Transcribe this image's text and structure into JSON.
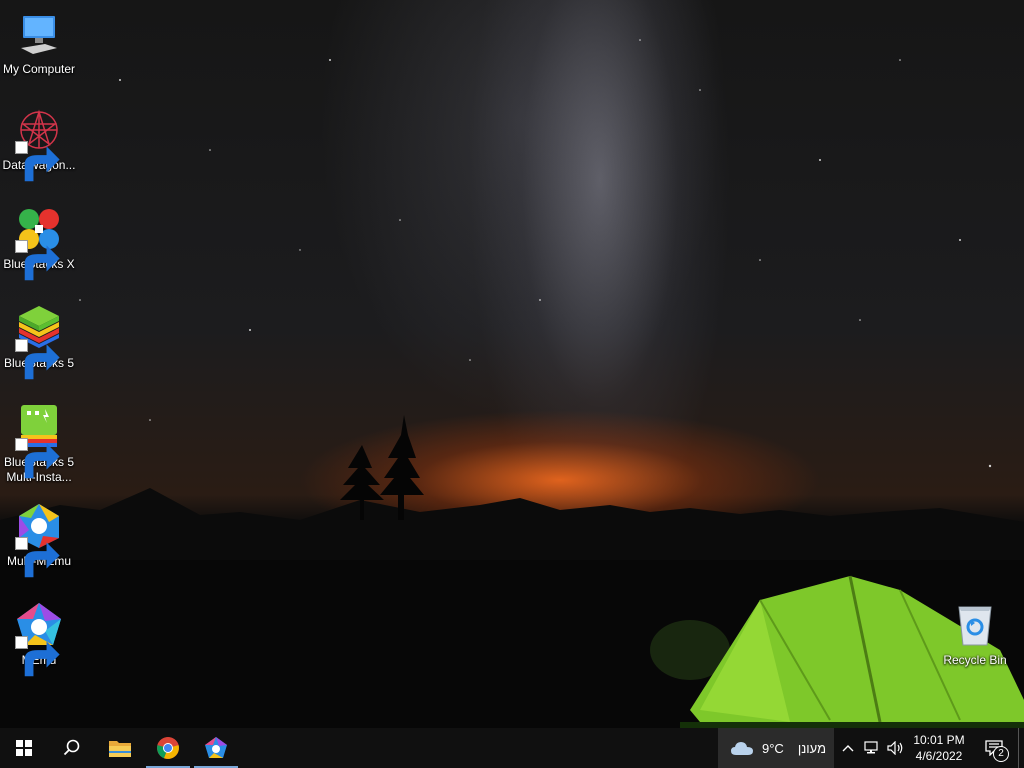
{
  "desktop": {
    "icons": [
      {
        "label": "My Computer",
        "icon": "monitor-icon"
      },
      {
        "label": "DataWagon...",
        "icon": "datawagon-icon"
      },
      {
        "label": "BlueStacks X",
        "icon": "bluestacks-x-icon"
      },
      {
        "label": "BlueStacks 5",
        "icon": "bluestacks-5-icon"
      },
      {
        "label": "BlueStacks 5 Multi-Insta...",
        "icon": "bluestacks-multi-instance-icon"
      },
      {
        "label": "Multi-MEmu",
        "icon": "multi-memu-icon"
      },
      {
        "label": "MEmu",
        "icon": "memu-icon"
      },
      {
        "label": "Recycle Bin",
        "icon": "recycle-bin-icon"
      }
    ]
  },
  "taskbar": {
    "pinned": [
      {
        "name": "start",
        "icon": "windows-logo-icon"
      },
      {
        "name": "search",
        "icon": "search-icon"
      },
      {
        "name": "file-explorer",
        "icon": "folder-icon"
      },
      {
        "name": "chrome",
        "icon": "chrome-icon"
      },
      {
        "name": "memu",
        "icon": "memu-icon"
      }
    ],
    "weather": {
      "temperature": "9°C",
      "condition": "מעונן",
      "icon": "cloud-icon"
    },
    "tray": {
      "icons": [
        "chevron-up-icon",
        "network-icon",
        "volume-icon"
      ]
    },
    "clock": {
      "time": "10:01 PM",
      "date": "4/6/2022"
    },
    "notifications": {
      "count": "2",
      "icon": "action-center-icon"
    }
  },
  "colors": {
    "taskbar_bg": "#101010",
    "weather_bg": "#2b2b2b",
    "active_indicator": "#7aa7d8",
    "tent_green": "#7ec82a"
  }
}
